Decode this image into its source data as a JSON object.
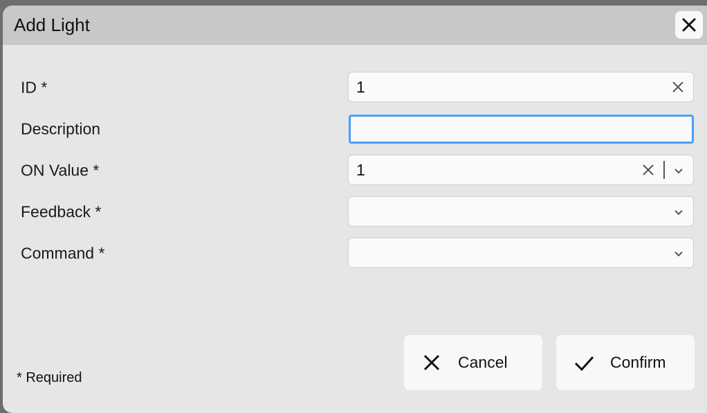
{
  "dialog": {
    "title": "Add Light",
    "close_icon": "close-icon"
  },
  "form": {
    "fields": [
      {
        "label": "ID *",
        "value": "1",
        "type": "text",
        "clearable": true
      },
      {
        "label": "Description",
        "value": "",
        "type": "text",
        "focused": true
      },
      {
        "label": "ON Value *",
        "value": "1",
        "type": "select",
        "clearable": true
      },
      {
        "label": "Feedback *",
        "value": "",
        "type": "select"
      },
      {
        "label": "Command *",
        "value": "",
        "type": "select"
      }
    ]
  },
  "footer": {
    "required_note": "* Required",
    "cancel_label": "Cancel",
    "confirm_label": "Confirm"
  },
  "colors": {
    "titlebar": "#c8c8c8",
    "body": "#e6e6e6",
    "focus": "#4a9ff5"
  }
}
